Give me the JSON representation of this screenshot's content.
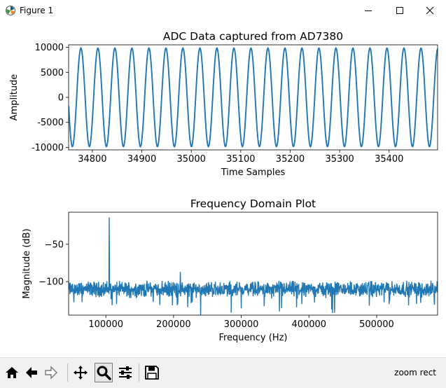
{
  "window": {
    "title": "Figure 1"
  },
  "toolbar": {
    "status": "zoom rect",
    "buttons": [
      "home-icon",
      "back-icon",
      "forward-icon",
      "pan-icon",
      "zoom-icon",
      "configure-icon",
      "save-icon"
    ]
  },
  "chart_data": [
    {
      "type": "line",
      "title": "ADC Data captured from AD7380",
      "xlabel": "Time Samples",
      "ylabel": "Amplitude",
      "xlim": [
        34752,
        35498
      ],
      "ylim": [
        -10500,
        10500
      ],
      "xticks": [
        34800,
        34900,
        35000,
        35100,
        35200,
        35300,
        35400
      ],
      "yticks": [
        10000,
        5000,
        0,
        -5000,
        -10000
      ],
      "series": [
        {
          "amplitude": 9850,
          "cycles": 21.7,
          "phase_deg": 190,
          "color": "#1f77b4"
        }
      ]
    },
    {
      "type": "line",
      "title": "Frequency Domain Plot",
      "xlabel": "Frequency (Hz)",
      "ylabel": "Magnitude (dB)",
      "xlim": [
        45000,
        590000
      ],
      "ylim": [
        -145,
        -7
      ],
      "xticks": [
        100000,
        200000,
        300000,
        400000,
        500000
      ],
      "yticks": [
        -50,
        -100
      ],
      "series": [
        {
          "noise_floor_db": -110,
          "peaks": [
            {
              "x": 105000,
              "y": -14
            },
            {
              "x": 210000,
              "y": -87
            }
          ],
          "color": "#1f77b4"
        }
      ]
    }
  ]
}
